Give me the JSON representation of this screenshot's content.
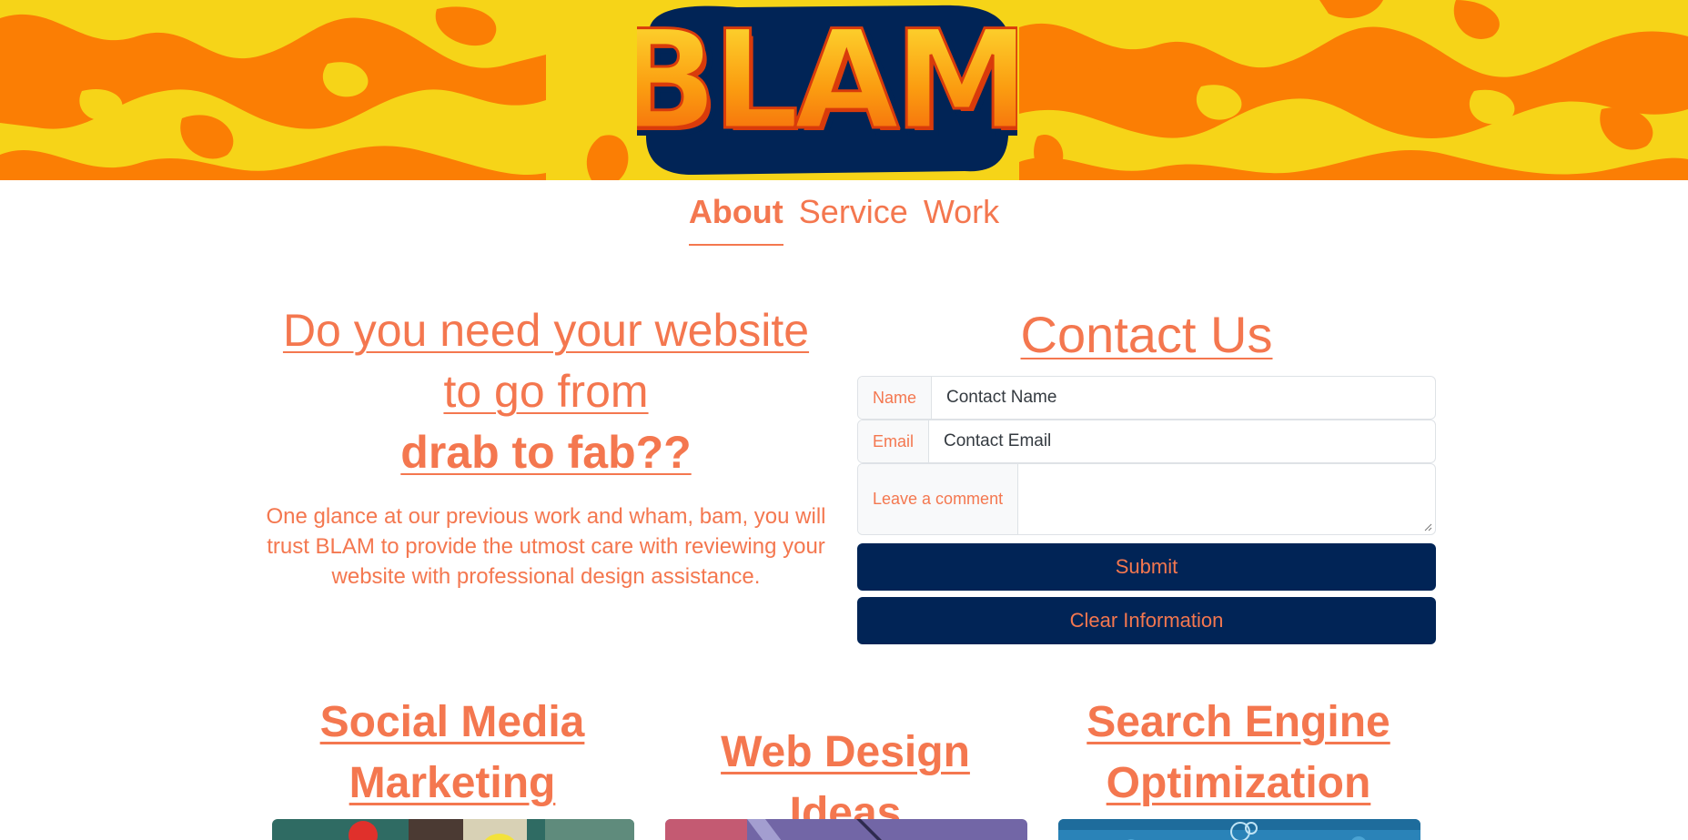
{
  "header": {
    "logo_icon": "blam-logo",
    "logo_text": "BLAM",
    "colors": {
      "banner_yellow": "#f6d418",
      "banner_orange": "#fb7e04",
      "logo_navy": "#012456"
    }
  },
  "nav": {
    "items": [
      {
        "label": "About",
        "active": true
      },
      {
        "label": "Service",
        "active": false
      },
      {
        "label": "Work",
        "active": false
      }
    ]
  },
  "hero": {
    "title_line1": "Do you need your website",
    "title_line2": "to go from",
    "title_line3": "drab to fab??",
    "body": "One glance at our previous work and wham, bam, you will trust BLAM to provide the utmost care with reviewing your website with professional design assistance."
  },
  "contact": {
    "heading": "Contact Us",
    "name_label": "Name",
    "name_value": "Contact Name",
    "email_label": "Email",
    "email_value": "Contact Email",
    "comment_label": "Leave a comment",
    "comment_value": "",
    "submit_label": "Submit",
    "clear_label": "Clear Information"
  },
  "services": [
    {
      "title_line1": "Social Media",
      "title_line2": "Marketing"
    },
    {
      "title_line1": "Web Design Ideas",
      "title_line2": ""
    },
    {
      "title_line1": "Search Engine",
      "title_line2": "Optimization"
    }
  ],
  "theme": {
    "accent": "#f4774f",
    "button_bg": "#012456",
    "border": "#dee2e6"
  }
}
